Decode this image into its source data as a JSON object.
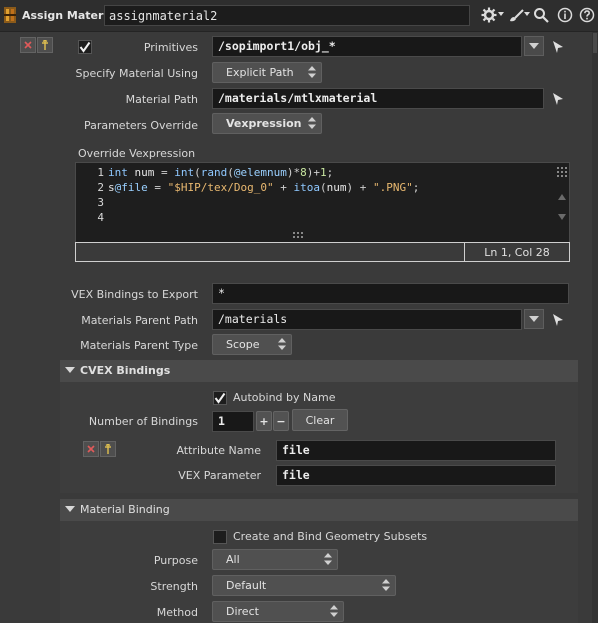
{
  "header": {
    "node_type": "Assign Material",
    "node_name": "assignmaterial2",
    "icons": [
      "gear-icon",
      "brush-icon",
      "search-icon",
      "info-icon",
      "help-icon"
    ]
  },
  "primitives": {
    "label": "Primitives",
    "value": "/sopimport1/obj_*",
    "enabled": true
  },
  "specify_material": {
    "label": "Specify Material Using",
    "value": "Explicit Path"
  },
  "material_path": {
    "label": "Material Path",
    "value": "/materials/mtlxmaterial"
  },
  "parameters_override": {
    "label": "Parameters Override",
    "value": "Vexpression"
  },
  "override_vex": {
    "label": "Override Vexpression",
    "line_numbers": [
      "1",
      "2",
      "3",
      "4"
    ],
    "lines": [
      "int num = int(rand(@elemnum)*8)+1;",
      "s@file = \"$HIP/tex/Dog_0\" + itoa(num) + \".PNG\";",
      "",
      ""
    ],
    "status": "Ln 1, Col 28"
  },
  "vex_bindings": {
    "label": "VEX Bindings to Export",
    "value": "*"
  },
  "materials_parent_path": {
    "label": "Materials Parent Path",
    "value": "/materials"
  },
  "materials_parent_type": {
    "label": "Materials Parent Type",
    "value": "Scope"
  },
  "cvex_section": {
    "title": "CVEX Bindings",
    "autobind": {
      "label": "Autobind by Name",
      "checked": true
    },
    "num_bindings": {
      "label": "Number of Bindings",
      "value": "1",
      "plus": "+",
      "minus": "−",
      "clear": "Clear"
    },
    "attribute_name": {
      "label": "Attribute Name",
      "value": "file"
    },
    "vex_parameter": {
      "label": "VEX Parameter",
      "value": "file"
    }
  },
  "material_binding": {
    "title": "Material Binding",
    "create_subsets": {
      "label": "Create and Bind Geometry Subsets",
      "checked": false
    },
    "purpose": {
      "label": "Purpose",
      "value": "All"
    },
    "strength": {
      "label": "Strength",
      "value": "Default"
    },
    "method": {
      "label": "Method",
      "value": "Direct"
    }
  },
  "colors": {
    "background": "#3a3a3a",
    "field": "#181818",
    "section": "#4a4a4a",
    "accent_red": "#e05a5a",
    "accent_yellow": "#e0c050"
  }
}
